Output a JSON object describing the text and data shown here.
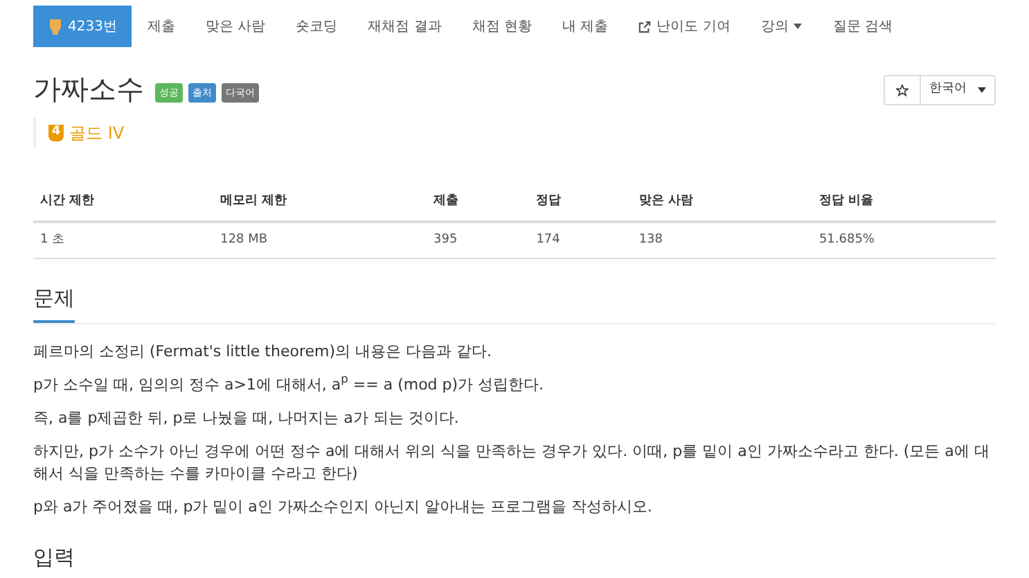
{
  "nav": {
    "items": [
      {
        "label": "4233번",
        "selected": true,
        "kind": "problem"
      },
      {
        "label": "제출",
        "selected": false,
        "kind": "plain"
      },
      {
        "label": "맞은 사람",
        "selected": false,
        "kind": "plain"
      },
      {
        "label": "숏코딩",
        "selected": false,
        "kind": "plain"
      },
      {
        "label": "재채점 결과",
        "selected": false,
        "kind": "plain"
      },
      {
        "label": "채점 현황",
        "selected": false,
        "kind": "plain"
      },
      {
        "label": "내 제출",
        "selected": false,
        "kind": "plain"
      },
      {
        "label": "난이도 기여",
        "selected": false,
        "kind": "external"
      },
      {
        "label": "강의",
        "selected": false,
        "kind": "dropdown"
      },
      {
        "label": "질문 검색",
        "selected": false,
        "kind": "plain"
      }
    ]
  },
  "problem": {
    "title": "가짜소수",
    "labels": [
      {
        "text": "성공",
        "color": "#5cb85c"
      },
      {
        "text": "출처",
        "color": "#428bca"
      },
      {
        "text": "다국어",
        "color": "#777777"
      }
    ],
    "tier": {
      "badge": "4",
      "name": "골드 IV"
    },
    "language": "한국어"
  },
  "stats": {
    "columns": [
      "시간 제한",
      "메모리 제한",
      "제출",
      "정답",
      "맞은 사람",
      "정답 비율"
    ],
    "rows": [
      [
        "1 초",
        "128 MB",
        "395",
        "174",
        "138",
        "51.685%"
      ]
    ]
  },
  "sections": [
    {
      "heading": "문제",
      "paragraphs": [
        "페르마의 소정리 (Fermat's little theorem)의 내용은 다음과 같다.",
        "p가 소수일 때, 임의의 정수 a>1에 대해서, a$^{p}$ == a (mod p)가 성립한다.",
        "즉, a를 p제곱한 뒤, p로 나눴을 때, 나머지는 a가 되는 것이다.",
        "하지만, p가 소수가 아닌 경우에 어떤 정수 a에 대해서 위의 식을 만족하는 경우가 있다. 이때, p를 밑이 a인 가짜소수라고 한다. (모든 a에 대해서 식을 만족하는 수를 카마이클 수라고 한다)",
        "p와 a가 주어졌을 때, p가 밑이 a인 가짜소수인지 아닌지 알아내는 프로그램을 작성하시오."
      ]
    },
    {
      "heading": "입력"
    }
  ]
}
